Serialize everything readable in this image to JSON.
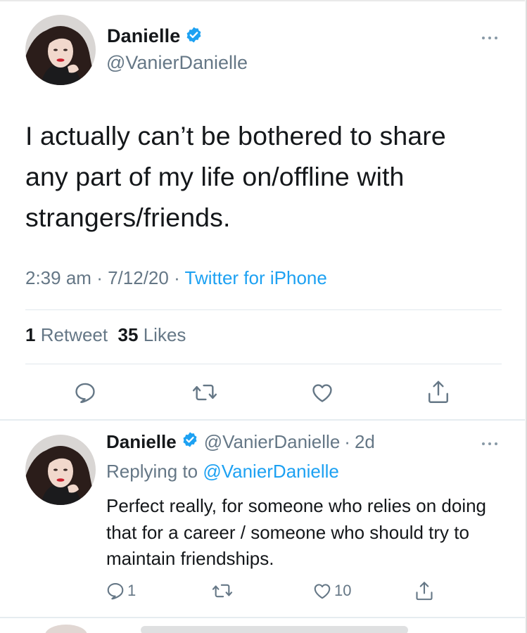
{
  "main_tweet": {
    "display_name": "Danielle",
    "verified": true,
    "handle": "@VanierDanielle",
    "text": "I actually can’t be bothered to share any part of my life on/offline with strangers/friends.",
    "time": "2:39 am",
    "date": "7/12/20",
    "source": "Twitter for iPhone",
    "separator": "·",
    "retweet_count": "1",
    "retweet_label": "Retweet",
    "like_count": "35",
    "like_label": "Likes",
    "more_icon": "more-horizontal-icon",
    "actions": [
      "reply-icon",
      "retweet-icon",
      "like-icon",
      "share-icon"
    ]
  },
  "reply": {
    "display_name": "Danielle",
    "verified": true,
    "handle": "@VanierDanielle",
    "age": "2d",
    "separator": "·",
    "replying_prefix": "Replying to",
    "replying_to": "@VanierDanielle",
    "text": "Perfect really, for someone who relies on doing that for a career / someone who should try to maintain friendships.",
    "reply_count": "1",
    "retweet_count": "",
    "like_count": "10",
    "more_icon": "more-horizontal-icon"
  },
  "colors": {
    "accent": "#1da1f2",
    "text_primary": "#14171a",
    "text_secondary": "#657786",
    "divider": "#e1e8ed"
  }
}
